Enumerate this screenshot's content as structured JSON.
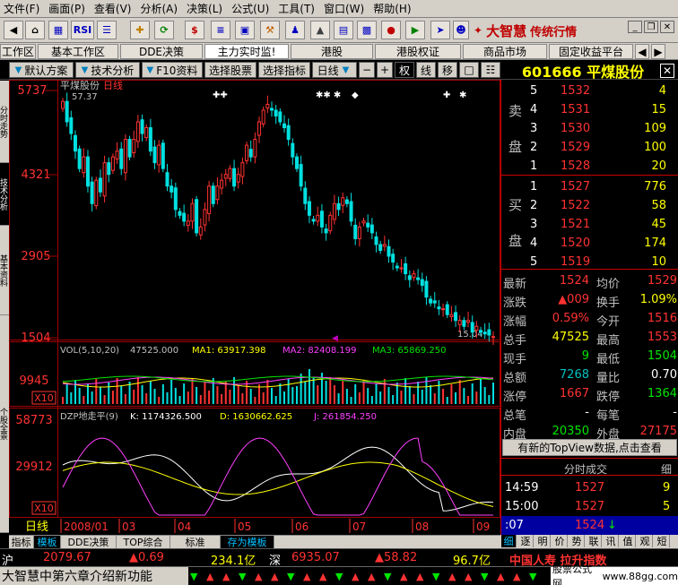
{
  "menu": [
    "文件(F)",
    "画面(P)",
    "查看(V)",
    "分析(A)",
    "决策(L)",
    "公式(U)",
    "工具(T)",
    "窗口(W)",
    "帮助(H)"
  ],
  "toolbar": {
    "brand_main": "大智慧",
    "brand_sub": "传统行情",
    "rsi_label": "RSI",
    "dollar_label": "$"
  },
  "tabs_top": [
    "工作区",
    "基本工作区",
    "DDE决策",
    "主力实时监!",
    "港股",
    "港股权证",
    "商品市场",
    "固定收益平台"
  ],
  "tabs_second": {
    "items": [
      "默认方案",
      "技术分析",
      "F10资料",
      "选择股票",
      "选择指标",
      "日线"
    ],
    "icon_buttons": [
      "权",
      "线",
      "移"
    ],
    "stock": "601666 平煤股份"
  },
  "left_tabs": [
    "分时走势",
    "技术分析",
    "基本资料",
    "个股全景"
  ],
  "chart": {
    "title": "平煤股份",
    "period": "日线",
    "max_label": "57.37",
    "min_label": "15.04",
    "price_axis": [
      "5737",
      "4321",
      "2905",
      "1504"
    ],
    "vol_header": {
      "name": "VOL(5,10,20)",
      "v": "47525.000",
      "ma1": "MA1: 63917.398",
      "ma2": "MA2: 82408.199",
      "ma3": "MA3: 65869.250"
    },
    "vol_axis": [
      "9945",
      "X10"
    ],
    "dzp_header": {
      "name": "DZP地走平(9)",
      "k": "K: 1174326.500",
      "d": "D: 1630662.625",
      "j": "J: 261854.250"
    },
    "dzp_axis": [
      "58773",
      "29912",
      "X10"
    ],
    "dates": [
      "2008/01",
      "03",
      "04",
      "05",
      "06",
      "07",
      "08",
      "09"
    ],
    "period_label": "日线"
  },
  "chart_data": {
    "type": "candlestick",
    "title": "平煤股份",
    "x": [
      "2008/01",
      "03",
      "04",
      "05",
      "06",
      "07",
      "08",
      "09"
    ],
    "price_range": [
      15.04,
      57.37
    ],
    "closes": [
      55.5,
      52,
      50,
      47,
      44,
      46,
      41,
      38,
      42,
      40,
      45,
      43,
      46,
      47,
      44,
      49,
      46,
      49,
      52,
      50,
      51,
      47,
      45,
      48,
      44,
      41,
      40,
      37,
      36,
      35,
      35,
      38,
      33,
      34,
      37,
      41,
      38,
      41,
      42,
      43,
      44,
      41,
      43,
      45,
      48,
      46,
      49,
      52,
      54,
      55,
      54,
      53,
      52,
      51,
      49,
      46,
      44,
      41,
      38,
      36,
      35,
      36,
      34,
      33,
      36,
      38,
      37,
      39,
      38,
      35,
      32,
      34,
      35,
      34,
      33,
      31,
      30,
      31,
      29,
      28,
      27,
      27,
      26,
      25,
      26,
      25,
      24,
      22,
      21,
      21,
      20,
      20,
      19,
      19,
      18,
      18,
      17,
      18,
      16,
      17,
      16,
      15.7,
      15.5,
      15.24
    ]
  },
  "order_book": {
    "sell_label": [
      "卖",
      "盘"
    ],
    "buy_label": [
      "买",
      "盘"
    ],
    "sell": [
      {
        "level": "5",
        "price": "1532",
        "vol": "4"
      },
      {
        "level": "4",
        "price": "1531",
        "vol": "15"
      },
      {
        "level": "3",
        "price": "1530",
        "vol": "109"
      },
      {
        "level": "2",
        "price": "1529",
        "vol": "100"
      },
      {
        "level": "1",
        "price": "1528",
        "vol": "20"
      }
    ],
    "buy": [
      {
        "level": "1",
        "price": "1527",
        "vol": "776"
      },
      {
        "level": "2",
        "price": "1522",
        "vol": "58"
      },
      {
        "level": "3",
        "price": "1521",
        "vol": "45"
      },
      {
        "level": "4",
        "price": "1520",
        "vol": "174"
      },
      {
        "level": "5",
        "price": "1519",
        "vol": "10"
      }
    ]
  },
  "stats": [
    {
      "l1": "最新",
      "v1": "1524",
      "c1": "red",
      "l2": "均价",
      "v2": "1529",
      "c2": "red"
    },
    {
      "l1": "涨跌",
      "v1": "▲009",
      "c1": "red",
      "l2": "换手",
      "v2": "1.09%",
      "c2": "yel"
    },
    {
      "l1": "涨幅",
      "v1": "0.59%",
      "c1": "red",
      "l2": "今开",
      "v2": "1516",
      "c2": "red"
    },
    {
      "l1": "总手",
      "v1": "47525",
      "c1": "yel",
      "l2": "最高",
      "v2": "1553",
      "c2": "red"
    },
    {
      "l1": "现手",
      "v1": "9",
      "c1": "grn",
      "l2": "最低",
      "v2": "1504",
      "c2": "grn"
    },
    {
      "l1": "总额",
      "v1": "7268",
      "c1": "cyan",
      "l2": "量比",
      "v2": "0.70",
      "c2": "wht"
    },
    {
      "l1": "涨停",
      "v1": "1667",
      "c1": "red",
      "l2": "跌停",
      "v2": "1364",
      "c2": "grn"
    },
    {
      "l1": "总笔",
      "v1": "-",
      "c1": "wht",
      "l2": "每笔",
      "v2": "-",
      "c2": "wht"
    },
    {
      "l1": "内盘",
      "v1": "20350",
      "c1": "grn",
      "l2": "外盘",
      "v2": "27175",
      "c2": "red"
    }
  ],
  "topview": "有新的TopView数据,点击查看",
  "ticks": {
    "header": "分时成交",
    "header_right": "细",
    "rows": [
      {
        "time": "14:59",
        "price": "1527",
        "vol": "9",
        "arrow": ""
      },
      {
        "time": "15:00",
        "price": "1527",
        "vol": "5",
        "arrow": ""
      },
      {
        "time": ":07",
        "price": "1524",
        "vol": "",
        "arrow": "↓"
      }
    ]
  },
  "bottom_tabs": [
    "指标",
    "模板",
    "DDE决策",
    "TOP综合",
    "标准",
    "存为模板"
  ],
  "right_tabs": [
    "细",
    "逐",
    "明",
    "价",
    "势",
    "联",
    "讯",
    "值",
    "观",
    "短"
  ],
  "status": {
    "sh_label": "沪",
    "sh_index": "2079.67",
    "sh_change": "▲0.69",
    "sh_amount": "234.1亿",
    "sz_label": "深",
    "sz_index": "6935.07",
    "sz_change": "▲58.82",
    "sz_amount": "96.7亿",
    "alert": "中国人寿 拉升指数"
  },
  "ticker": {
    "text": "大智慧中第六章介绍新功能",
    "ad": "股票公式网",
    "url": "www.88gg.com"
  }
}
